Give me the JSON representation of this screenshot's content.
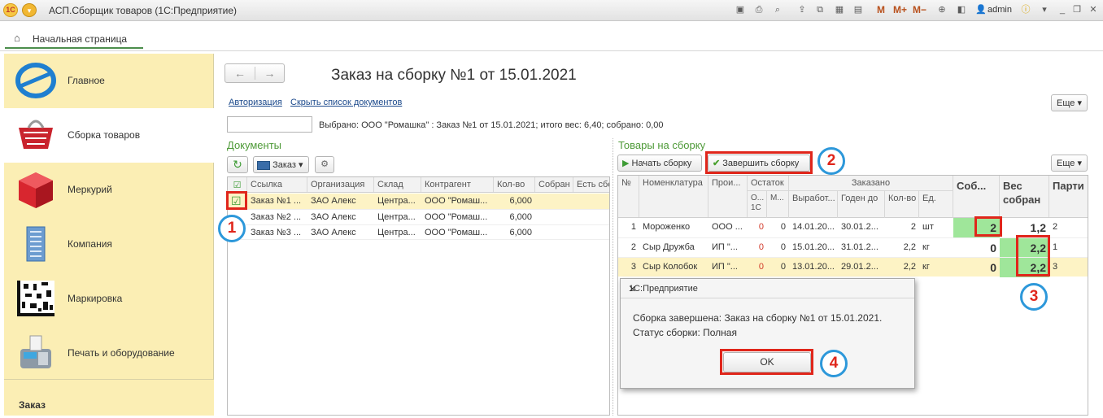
{
  "window": {
    "title": "АСП.Сборщик товаров  (1С:Предприятие)",
    "user": "admin",
    "mem_buttons": [
      "M",
      "M+",
      "M−"
    ]
  },
  "tabs": [
    {
      "label": "Начальная страница"
    }
  ],
  "sidebar": {
    "items": [
      {
        "label": "Главное"
      },
      {
        "label": "Сборка товаров"
      },
      {
        "label": "Меркурий"
      },
      {
        "label": "Компания"
      },
      {
        "label": "Маркировка"
      },
      {
        "label": "Печать и оборудование"
      }
    ],
    "footer": "Заказ"
  },
  "form": {
    "title": "Заказ на сборку №1 от 15.01.2021",
    "link_auth": "Авторизация",
    "link_hide": "Скрыть список документов",
    "more_label": "Еще ▾",
    "selected_text": "Выбрано: ООО \"Ромашка\" : Заказ №1 от 15.01.2021; итого вес: 6,40; собрано: 0,00"
  },
  "documents": {
    "section_title": "Документы",
    "order_filter": "Заказ",
    "columns": [
      "Ссылка",
      "Организация",
      "Склад",
      "Контрагент",
      "Кол-во",
      "Собран",
      "Есть сбо"
    ],
    "rows": [
      {
        "checked": true,
        "link": "Заказ №1 ...",
        "org": "ЗАО Алекс",
        "wh": "Центра...",
        "partner": "ООО \"Ромаш...",
        "qty": "6,000",
        "done": "",
        "has": ""
      },
      {
        "checked": false,
        "link": "Заказ №2 ...",
        "org": "ЗАО Алекс",
        "wh": "Центра...",
        "partner": "ООО \"Ромаш...",
        "qty": "6,000",
        "done": "",
        "has": ""
      },
      {
        "checked": false,
        "link": "Заказ №3 ...",
        "org": "ЗАО Алекс",
        "wh": "Центра...",
        "partner": "ООО \"Ромаш...",
        "qty": "6,000",
        "done": "",
        "has": ""
      }
    ]
  },
  "goods": {
    "section_title": "Товары на сборку",
    "btn_start": "Начать сборку",
    "btn_finish": "Завершить сборку",
    "more_label": "Еще ▾",
    "headers": {
      "n": "№",
      "name": "Номенклатура",
      "prod": "Прои...",
      "rest": "Остаток",
      "rest_1c": "О... 1С",
      "rest_m": "М...",
      "ordered": "Заказано",
      "made": "Выработ...",
      "till": "Годен до",
      "qty": "Кол-во",
      "unit": "Ед.",
      "collected": "Соб...",
      "weight": "Вес собран",
      "party": "Парти"
    },
    "rows": [
      {
        "n": "1",
        "name": "Мороженко",
        "prod": "ООО ...",
        "r1": "0",
        "r2": "0",
        "made": "14.01.20...",
        "till": "30.01.2...",
        "qty": "2",
        "unit": "шт",
        "collected": "2",
        "weight": "1,2",
        "party": "2"
      },
      {
        "n": "2",
        "name": "Сыр Дружба",
        "prod": "ИП \"...",
        "r1": "0",
        "r2": "0",
        "made": "15.01.20...",
        "till": "31.01.2...",
        "qty": "2,2",
        "unit": "кг",
        "collected": "0",
        "weight": "2,2",
        "party": "1"
      },
      {
        "n": "3",
        "name": "Сыр Колобок",
        "prod": "ИП \"...",
        "r1": "0",
        "r2": "0",
        "made": "13.01.20...",
        "till": "29.01.2...",
        "qty": "2,2",
        "unit": "кг",
        "collected": "0",
        "weight": "2,2",
        "party": "3"
      }
    ]
  },
  "dialog": {
    "title": "1С:Предприятие",
    "line1": "Сборка завершена: Заказ на сборку №1 от 15.01.2021.",
    "line2": "Статус сборки: Полная",
    "ok": "OK"
  },
  "annotations": [
    "1",
    "2",
    "3",
    "4"
  ],
  "colors": {
    "accent_green": "#4e9a38",
    "highlight_red": "#e0261b",
    "callout_blue": "#2d98da",
    "sidebar_bg": "#fbeeb4",
    "selected_row": "#fdf3c5"
  }
}
